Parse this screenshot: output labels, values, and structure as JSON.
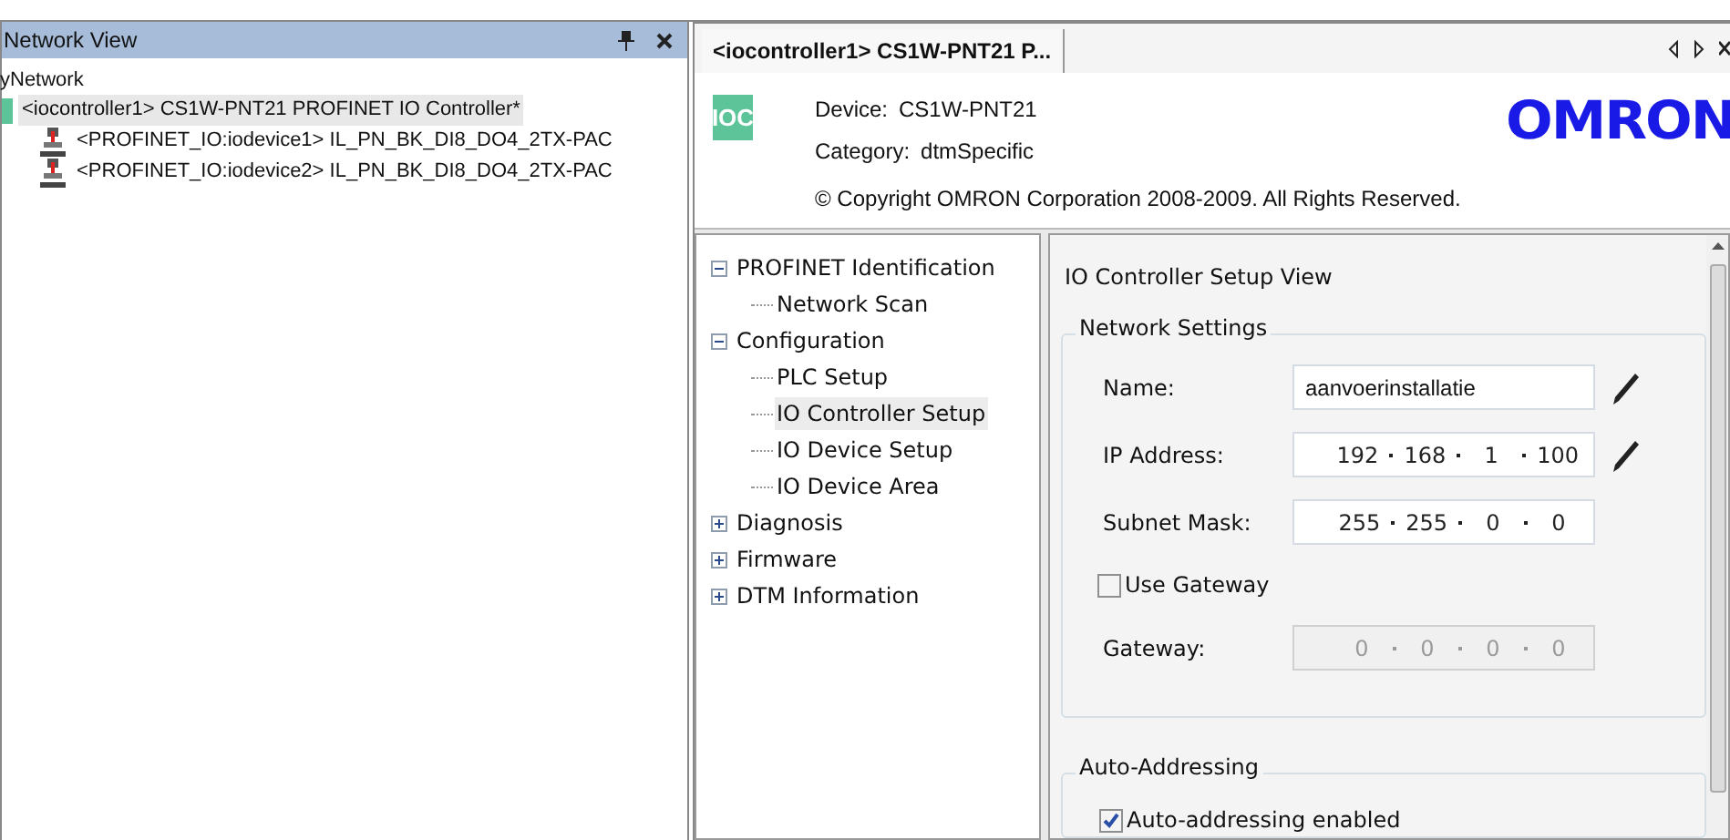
{
  "network_view": {
    "title": "Network View",
    "root": "yNetwork",
    "items": [
      {
        "kind": "controller",
        "label": "<iocontroller1> CS1W-PNT21 PROFINET IO Controller*",
        "selected": true
      },
      {
        "kind": "device",
        "label": "<PROFINET_IO:iodevice1> IL_PN_BK_DI8_DO4_2TX-PAC",
        "selected": false
      },
      {
        "kind": "device",
        "label": "<PROFINET_IO:iodevice2> IL_PN_BK_DI8_DO4_2TX-PAC",
        "selected": false
      }
    ]
  },
  "document_tab": {
    "label": "<iocontroller1> CS1W-PNT21 P...",
    "selected": true
  },
  "header": {
    "icon_text": "IOC",
    "device_label": "Device:",
    "device": "CS1W-PNT21",
    "category_label": "Category:",
    "category": "dtmSpecific",
    "copyright": "© Copyright OMRON Corporation 2008-2009. All Rights Reserved.",
    "logo": "OMRON"
  },
  "nav_tree": [
    {
      "label": "PROFINET Identification",
      "expanded": true,
      "selected": false,
      "children": [
        {
          "label": "Network Scan",
          "selected": false
        }
      ]
    },
    {
      "label": "Configuration",
      "expanded": true,
      "selected": false,
      "children": [
        {
          "label": "PLC Setup",
          "selected": false
        },
        {
          "label": "IO Controller Setup",
          "selected": true
        },
        {
          "label": "IO Device Setup",
          "selected": false
        },
        {
          "label": "IO Device Area",
          "selected": false
        }
      ]
    },
    {
      "label": "Diagnosis",
      "expanded": false,
      "selected": false
    },
    {
      "label": "Firmware",
      "expanded": false,
      "selected": false
    },
    {
      "label": "DTM Information",
      "expanded": false,
      "selected": false
    }
  ],
  "setup_view": {
    "title": "IO Controller Setup View",
    "network_settings": {
      "title": "Network Settings",
      "rows": [
        {
          "kind": "text",
          "label": "Name:",
          "value": "aanvoerinstallatie",
          "editable": true
        },
        {
          "kind": "ip",
          "label": "IP Address:",
          "octets": [
            "192",
            "168",
            "1",
            "100"
          ],
          "editable": true
        },
        {
          "kind": "ip",
          "label": "Subnet Mask:",
          "octets": [
            "255",
            "255",
            "0",
            "0"
          ]
        },
        {
          "kind": "checkbox",
          "label": "Use Gateway",
          "checked": false
        },
        {
          "kind": "ip",
          "label": "Gateway:",
          "octets": [
            "0",
            "0",
            "0",
            "0"
          ],
          "disabled": true
        }
      ]
    },
    "auto_addressing": {
      "title": "Auto-Addressing",
      "checkbox": {
        "label": "Auto-addressing enabled",
        "checked": true
      }
    }
  }
}
